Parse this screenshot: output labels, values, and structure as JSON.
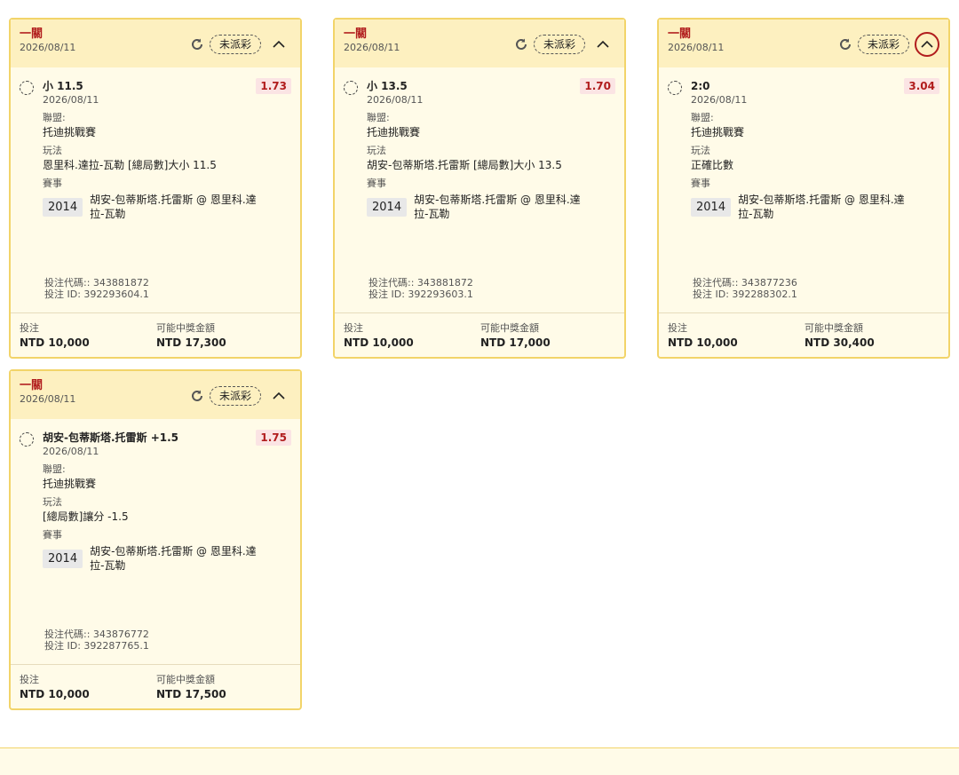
{
  "cards": [
    {
      "type": "一關",
      "header_date": "2026/08/11",
      "status": "未派彩",
      "selection": "小 11.5",
      "selection_date": "2026/08/11",
      "odds": "1.73",
      "league_label": "聯盟:",
      "league": "托迪挑戰賽",
      "bet_type_label": "玩法",
      "bet_type": "恩里科.達拉-瓦勒 [總局數]大小 11.5",
      "event_label": "賽事",
      "event_year": "2014",
      "event_name": "胡安-包蒂斯塔.托雷斯 @ 恩里科.達拉-瓦勒",
      "bet_code": "投注代碼:: 343881872",
      "bet_id": "投注 ID: 392293604.1",
      "stake_label": "投注",
      "stake": "NTD 10,000",
      "payout_label": "可能中獎金額",
      "payout": "NTD 17,300"
    },
    {
      "type": "一關",
      "header_date": "2026/08/11",
      "status": "未派彩",
      "selection": "小 13.5",
      "selection_date": "2026/08/11",
      "odds": "1.70",
      "league_label": "聯盟:",
      "league": "托迪挑戰賽",
      "bet_type_label": "玩法",
      "bet_type": "胡安-包蒂斯塔.托雷斯 [總局數]大小 13.5",
      "event_label": "賽事",
      "event_year": "2014",
      "event_name": "胡安-包蒂斯塔.托雷斯 @ 恩里科.達拉-瓦勒",
      "bet_code": "投注代碼:: 343881872",
      "bet_id": "投注 ID: 392293603.1",
      "stake_label": "投注",
      "stake": "NTD 10,000",
      "payout_label": "可能中獎金額",
      "payout": "NTD 17,000"
    },
    {
      "type": "一關",
      "header_date": "2026/08/11",
      "status": "未派彩",
      "selection": "2:0",
      "selection_date": "2026/08/11",
      "odds": "3.04",
      "league_label": "聯盟:",
      "league": "托迪挑戰賽",
      "bet_type_label": "玩法",
      "bet_type": "正確比數",
      "event_label": "賽事",
      "event_year": "2014",
      "event_name": "胡安-包蒂斯塔.托雷斯 @ 恩里科.達拉-瓦勒",
      "bet_code": "投注代碼:: 343877236",
      "bet_id": "投注 ID: 392288302.1",
      "stake_label": "投注",
      "stake": "NTD 10,000",
      "payout_label": "可能中獎金額",
      "payout": "NTD 30,400"
    },
    {
      "type": "一關",
      "header_date": "2026/08/11",
      "status": "未派彩",
      "selection": "胡安-包蒂斯塔.托雷斯 +1.5",
      "selection_date": "2026/08/11",
      "odds": "1.75",
      "league_label": "聯盟:",
      "league": "托迪挑戰賽",
      "bet_type_label": "玩法",
      "bet_type": "[總局數]讓分 -1.5",
      "event_label": "賽事",
      "event_year": "2014",
      "event_name": "胡安-包蒂斯塔.托雷斯 @ 恩里科.達拉-瓦勒",
      "bet_code": "投注代碼:: 343876772",
      "bet_id": "投注 ID: 392287765.1",
      "stake_label": "投注",
      "stake": "NTD 10,000",
      "payout_label": "可能中獎金額",
      "payout": "NTD 17,500"
    }
  ],
  "icons": {
    "refresh": "refresh-icon",
    "collapse": "chevron-up-icon",
    "selection": "radio-icon"
  },
  "colors": {
    "accent_red": "#b11d1d",
    "card_border": "#f2d469",
    "header_bg": "#fdf0c0",
    "card_bg": "#fffbe8"
  }
}
